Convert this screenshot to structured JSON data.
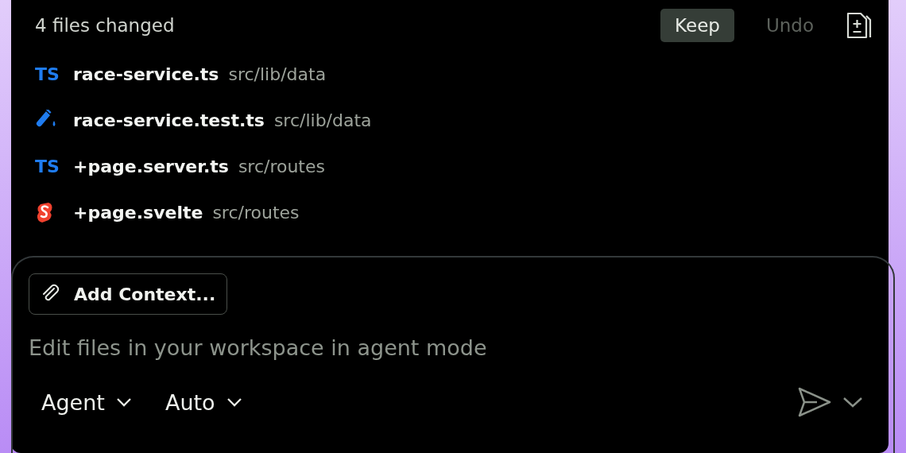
{
  "changes": {
    "title": "4 files changed",
    "actions": [
      {
        "label": "Keep",
        "kind": "primary",
        "disabled": false
      },
      {
        "label": "Undo",
        "kind": "plain",
        "disabled": true
      }
    ],
    "files": [
      {
        "kind": "ts",
        "icon_text": "TS",
        "name": "race-service.ts",
        "path": "src/lib/data"
      },
      {
        "kind": "test",
        "name": "race-service.test.ts",
        "path": "src/lib/data"
      },
      {
        "kind": "ts",
        "icon_text": "TS",
        "name": "+page.server.ts",
        "path": "src/routes"
      },
      {
        "kind": "svelte",
        "name": "+page.svelte",
        "path": "src/routes"
      }
    ]
  },
  "composer": {
    "context_button": "Add Context...",
    "placeholder": "Edit files in your workspace in agent mode",
    "pickers": [
      "Agent",
      "Auto"
    ]
  }
}
